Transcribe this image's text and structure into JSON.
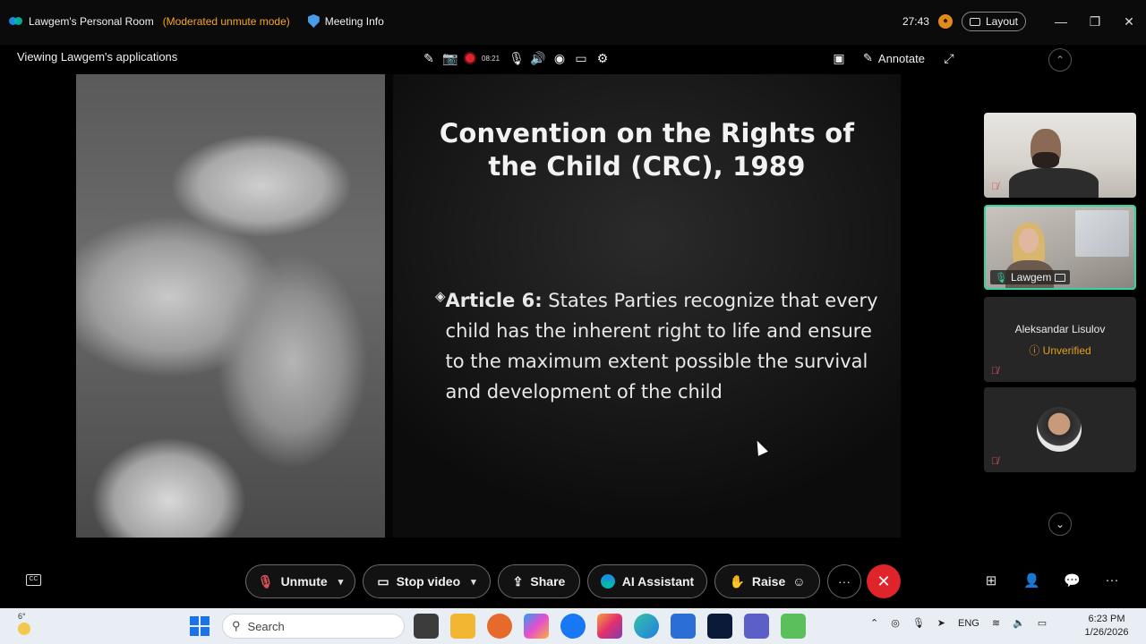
{
  "titlebar": {
    "room_title": "Lawgem's Personal Room",
    "mode": "(Moderated unmute mode)",
    "meeting_info": "Meeting Info",
    "timer": "27:43",
    "layout_label": "Layout"
  },
  "subbar": {
    "viewing": "Viewing Lawgem's applications",
    "record_time": "08:21",
    "annotate_label": "Annotate"
  },
  "slide": {
    "title_line1": "Convention on the Rights of",
    "title_line2": "the Child (CRC), 1989",
    "bullet_bold": "Article 6:",
    "bullet_text": " States Parties recognize that every child has the inherent right to life and ensure to the maximum extent possible the survival and development of the child"
  },
  "participants": [
    {
      "name": ""
    },
    {
      "name": "Lawgem"
    },
    {
      "name": "Aleksandar Lisulov",
      "status": "Unverified"
    },
    {
      "name": ""
    }
  ],
  "controls": {
    "unmute": "Unmute",
    "stop_video": "Stop video",
    "share": "Share",
    "ai_assistant": "AI Assistant",
    "raise": "Raise"
  },
  "taskbar": {
    "weather_temp": "6°",
    "search_placeholder": "Search",
    "language": "ENG",
    "time": "6:23 PM",
    "date": "1/26/2026"
  },
  "colors": {
    "accent_teal": "#2fd4a8",
    "leave_red": "#e0242b",
    "mode_orange": "#f5a623",
    "muted_red": "#e0535b"
  }
}
